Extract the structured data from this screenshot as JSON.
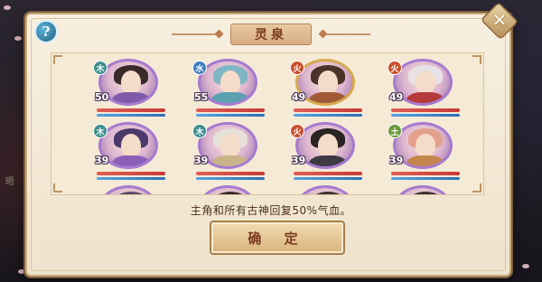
{
  "dialog": {
    "title": "灵泉",
    "help_glyph": "?",
    "close_glyph": "✕",
    "description": "主角和所有古神回复50%气血。",
    "confirm_label": "确 定"
  },
  "background": {
    "hint_1": "",
    "hint_2": "晤"
  },
  "characters": [
    {
      "level": "50",
      "element": "木",
      "element_color": "#3f8f8f",
      "hair": "#3a2a2a",
      "robe": "#7e5aa8",
      "ring": "purple",
      "hp": 1.0,
      "mp": 1.0
    },
    {
      "level": "55",
      "element": "水",
      "element_color": "#3f7fbf",
      "hair": "#7fb6c4",
      "robe": "#5aa0b0",
      "ring": "purple",
      "hp": 1.0,
      "mp": 1.0
    },
    {
      "level": "49",
      "element": "火",
      "element_color": "#c8502e",
      "hair": "#4a3328",
      "robe": "#a05a36",
      "ring": "gold",
      "hp": 1.0,
      "mp": 1.0
    },
    {
      "level": "49",
      "element": "火",
      "element_color": "#c8502e",
      "hair": "#e8e2e6",
      "robe": "#b53a3a",
      "ring": "purple",
      "hp": 1.0,
      "mp": 1.0
    },
    {
      "level": "39",
      "element": "木",
      "element_color": "#3f8f8f",
      "hair": "#4a3a6a",
      "robe": "#8c5fb6",
      "ring": "purple",
      "hp": 1.0,
      "mp": 1.0
    },
    {
      "level": "39",
      "element": "木",
      "element_color": "#3f8f8f",
      "hair": "#e6e0d8",
      "robe": "#c9b48a",
      "ring": "purple",
      "hp": 1.0,
      "mp": 1.0
    },
    {
      "level": "39",
      "element": "火",
      "element_color": "#c8502e",
      "hair": "#2b2424",
      "robe": "#3d3a44",
      "ring": "purple",
      "hp": 1.0,
      "mp": 1.0
    },
    {
      "level": "39",
      "element": "土",
      "element_color": "#6c9a3a",
      "hair": "#e3a08c",
      "robe": "#c5864d",
      "ring": "purple",
      "hp": 1.0,
      "mp": 1.0
    },
    {
      "level": "",
      "element": "",
      "element_color": "#7e5aa8",
      "hair": "#5a4a6a",
      "robe": "#7e5aa8",
      "ring": "purple",
      "hp": 1.0,
      "mp": 1.0
    },
    {
      "level": "",
      "element": "",
      "element_color": "#7e5aa8",
      "hair": "#3a2a2a",
      "robe": "#7e5aa8",
      "ring": "purple",
      "hp": 1.0,
      "mp": 1.0
    },
    {
      "level": "",
      "element": "",
      "element_color": "#6c9a3a",
      "hair": "#3a3030",
      "robe": "#6c9a3a",
      "ring": "purple",
      "hp": 1.0,
      "mp": 1.0
    },
    {
      "level": "",
      "element": "",
      "element_color": "#6c9a3a",
      "hair": "#3a3030",
      "robe": "#6c9a3a",
      "ring": "purple",
      "hp": 1.0,
      "mp": 1.0
    }
  ],
  "colors": {
    "panel": "#f7efdf",
    "title_text": "#7a3a1e",
    "hp": "#c73b34",
    "mp": "#2c6fb3"
  }
}
